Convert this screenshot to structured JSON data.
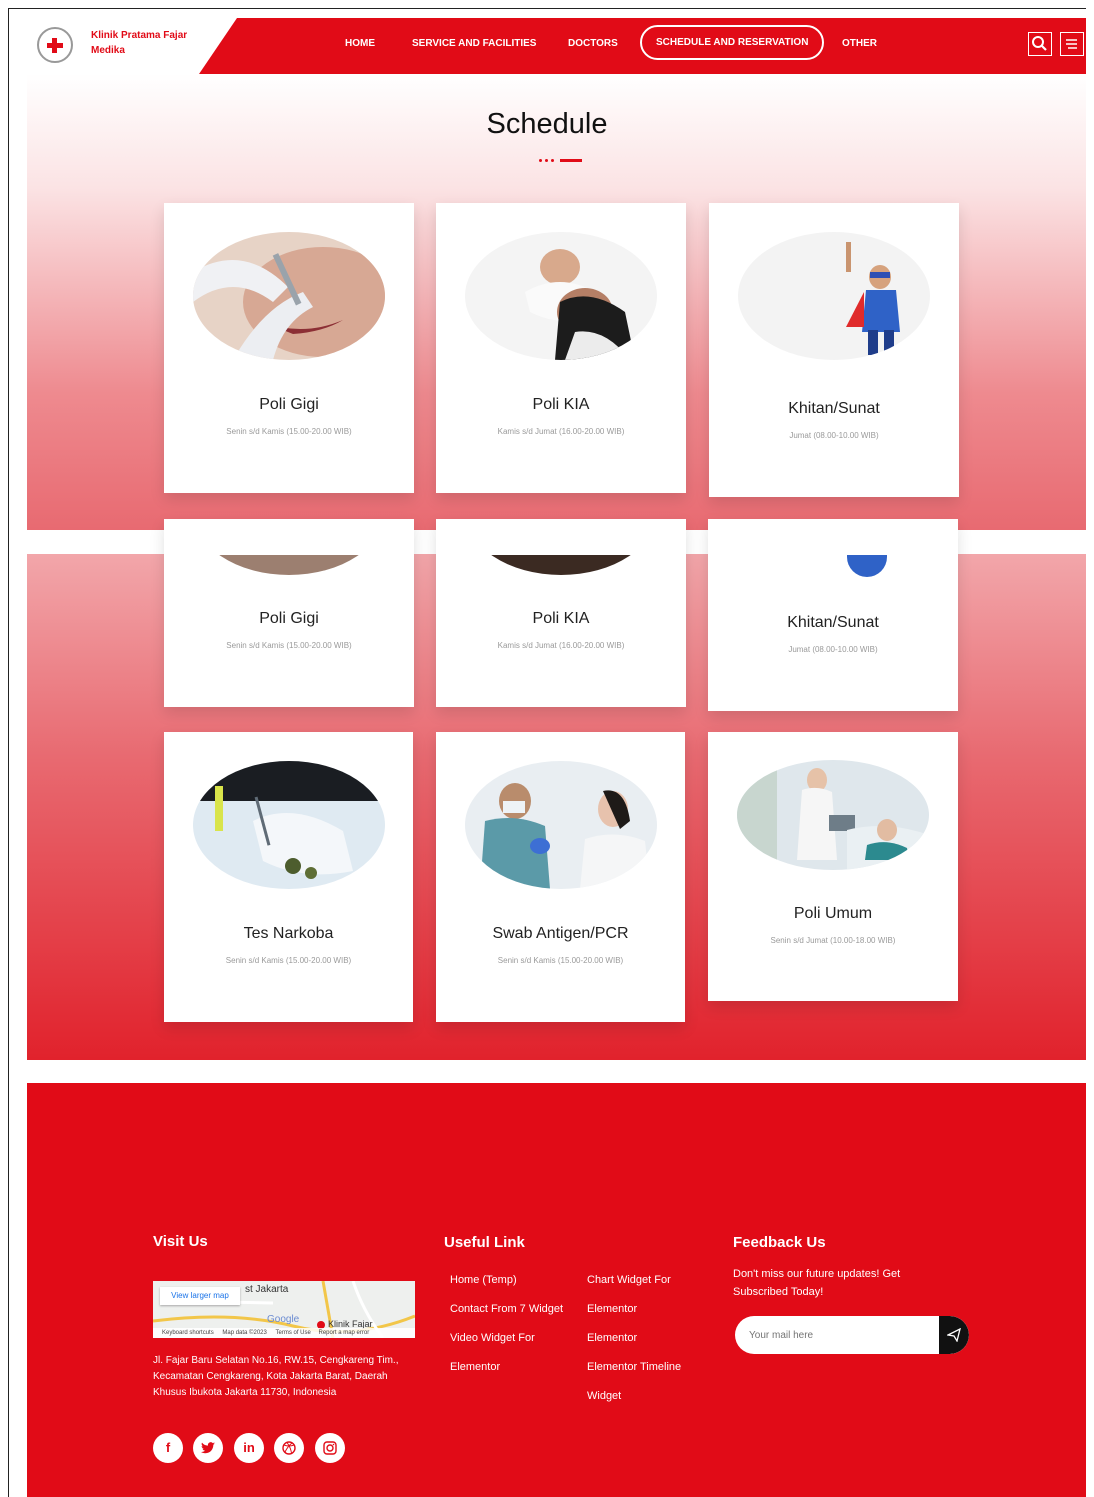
{
  "header": {
    "brand": "Klinik Pratama Fajar Medika",
    "nav": [
      "HOME",
      "SERVICE AND FACILITIES",
      "DOCTORS",
      "SCHEDULE AND RESERVATION",
      "OTHER"
    ],
    "icons": [
      "search-icon",
      "menu-icon"
    ]
  },
  "schedule": {
    "title": "Schedule",
    "cards_top": [
      {
        "name": "Poli Gigi",
        "schedule": "Senin s/d Kamis (15.00-20.00 WIB)"
      },
      {
        "name": "Poli KIA",
        "schedule": "Kamis s/d Jumat (16.00-20.00 WIB)"
      },
      {
        "name": "Khitan/Sunat",
        "schedule": "Jumat (08.00-10.00 WIB)"
      }
    ],
    "cards_mid": [
      {
        "name": "Poli Gigi",
        "schedule": "Senin s/d Kamis (15.00-20.00 WIB)"
      },
      {
        "name": "Poli KIA",
        "schedule": "Kamis s/d Jumat (16.00-20.00 WIB)"
      },
      {
        "name": "Khitan/Sunat",
        "schedule": "Jumat (08.00-10.00 WIB)"
      }
    ],
    "cards_bottom": [
      {
        "name": "Tes Narkoba",
        "schedule": "Senin s/d Kamis (15.00-20.00 WIB)"
      },
      {
        "name": "Swab Antigen/PCR",
        "schedule": "Senin s/d Kamis (15.00-20.00 WIB)"
      },
      {
        "name": "Poli Umum",
        "schedule": "Senin s/d Jumat (10.00-18.00 WIB)"
      }
    ]
  },
  "footer": {
    "visit_title": "Visit Us",
    "map": {
      "view_larger": "View larger map",
      "city_label": "st Jakarta",
      "google": "Google",
      "pin_label": "Klinik Fajar",
      "shortcuts": "Keyboard shortcuts",
      "map_data": "Map data ©2023",
      "terms": "Terms of Use",
      "report": "Report a map error"
    },
    "address": "Jl. Fajar Baru Selatan No.16, RW.15, Cengkareng Tim., Kecamatan Cengkareng, Kota Jakarta Barat, Daerah Khusus Ibukota Jakarta 11730, Indonesia",
    "social_icons": [
      "facebook-icon",
      "twitter-icon",
      "linkedin-icon",
      "dribbble-icon",
      "instagram-icon"
    ],
    "useful_title": "Useful Link",
    "links_col1": [
      "Home (Temp)",
      "Contact From 7 Widget",
      "Video Widget For",
      "Elementor"
    ],
    "links_col2": [
      "Chart Widget For",
      "Elementor",
      "Elementor",
      "Elementor Timeline",
      "Widget"
    ],
    "feedback_title": "Feedback Us",
    "feedback_text": "Don't miss our future updates! Get Subscribed Today!",
    "email_placeholder": "Your mail here",
    "send_icon": "send-icon"
  }
}
